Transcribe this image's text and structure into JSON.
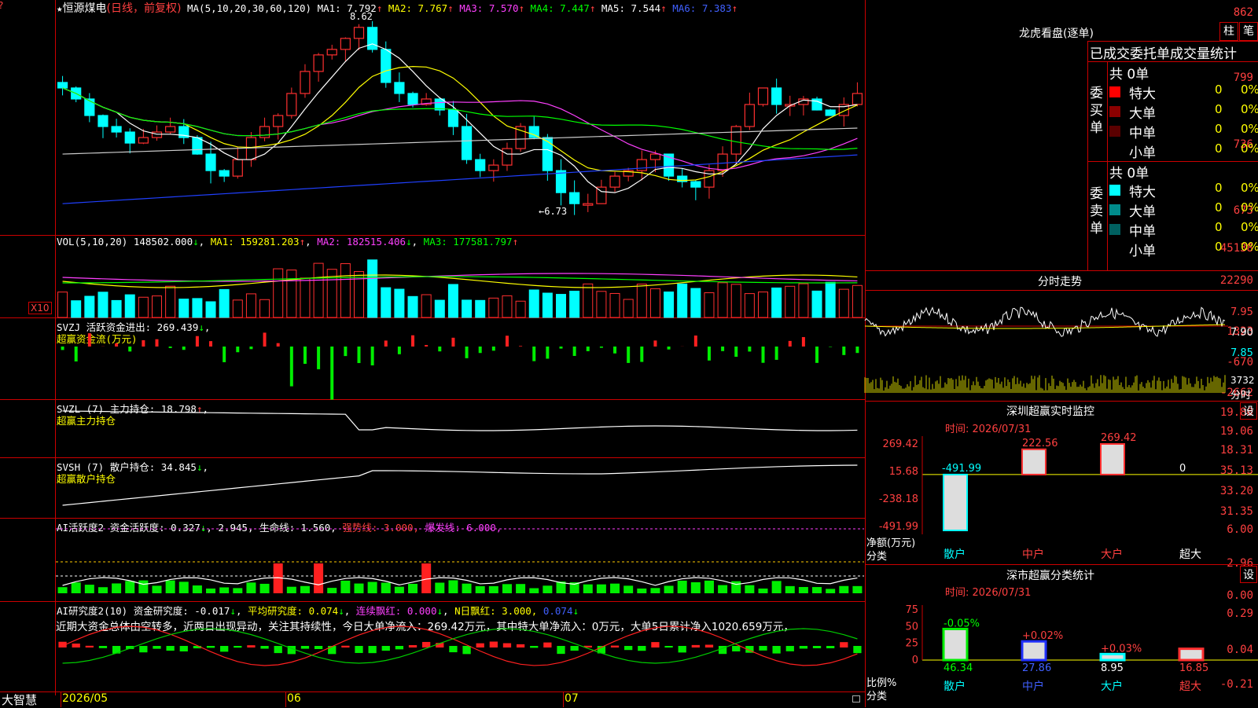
{
  "stock": {
    "star": "★",
    "name": "恒源煤电",
    "mode": "(日线，前复权)",
    "ma_label": "MA(5,10,20,30,60,120)",
    "ma_values": [
      {
        "label": "MA1:",
        "value": "7.792",
        "arrow": "↑",
        "color": "#ffffff"
      },
      {
        "label": "MA2:",
        "value": "7.767",
        "arrow": "↑",
        "color": "#ffff00"
      },
      {
        "label": "MA3:",
        "value": "7.570",
        "arrow": "↑",
        "color": "#ff40ff"
      },
      {
        "label": "MA4:",
        "value": "7.447",
        "arrow": "↑",
        "color": "#00ff00"
      },
      {
        "label": "MA5:",
        "value": "7.544",
        "arrow": "↑",
        "color": "#ffffff"
      },
      {
        "label": "MA6:",
        "value": "7.383",
        "arrow": "↑",
        "color": "#4060ff"
      }
    ],
    "high_mark": "8.62",
    "low_mark": "←6.73"
  },
  "price_axis": [
    "862",
    "799",
    "736",
    "673"
  ],
  "vol": {
    "header": "VOL(5,10,20)",
    "value": "148502.000",
    "arrow": "↓",
    "ma1": "MA1: 159281.203",
    "ma1_arrow": "↑",
    "ma2": "MA2: 182515.406",
    "ma2_arrow": "↓",
    "ma3": "MA3: 177581.797",
    "ma3_arrow": "↑",
    "axis": [
      "45138",
      "22290"
    ],
    "unit": "X10"
  },
  "svzj": {
    "header": "SVZJ  活跃资金进出: 269.439",
    "arrow": "↓",
    "sub": "超赢资金流(万元)",
    "axis": [
      "1323",
      "-670",
      "-2662"
    ]
  },
  "svzl": {
    "header": "SVZL (7) 主力持仓: 18.798",
    "arrow": "↑",
    "sub": "超赢主力持仓",
    "axis": [
      "19.80",
      "19.06",
      "18.31"
    ]
  },
  "svsh": {
    "header": "SVSH (7) 散户持仓: 34.845",
    "arrow": "↓",
    "sub": "超赢散户持仓",
    "axis": [
      "35.13",
      "33.20",
      "31.35"
    ]
  },
  "ai_active": {
    "header": "AI活跃度2 资金活跃度: 0.327",
    "a1": "↓",
    "v2": "2.945",
    "life": "生命线: 1.560,",
    "strong": "强势线: 3.000,",
    "burst": "爆发线: 6.000,",
    "axis": [
      "6.00",
      "2.96",
      "0.00"
    ]
  },
  "ai_research": {
    "h1": "AI研究度2(10) 资金研究度: -0.017",
    "a1": "↓",
    "h2": "平均研究度: 0.074",
    "a2": "↓",
    "h3": "连续飘红: 0.000",
    "a3": "↓",
    "h4": "N日飘红: 3.000,",
    "h5": "0.074",
    "a5": "↓",
    "note": "近期大资金总体由空转多，近两日出现异动，关注其持续性，今日大单净流入：269.42万元，其中特大单净流入：0万元，大单5日累计净入1020.659万元，",
    "axis": [
      "0.29",
      "0.04",
      "-0.21"
    ]
  },
  "bottom": {
    "brand": "大智慧",
    "dates": [
      "2026/05",
      "06",
      "07"
    ]
  },
  "dragon": {
    "title": "龙虎看盘(逐单)",
    "btn1": "柱",
    "btn2": "笔",
    "section": "已成交委托单成交量统计",
    "buy": {
      "label": "委买单",
      "total": "共 0单",
      "rows": [
        {
          "name": "特大",
          "n": "0",
          "p": "0%",
          "color": "#ff0000"
        },
        {
          "name": "大单",
          "n": "0",
          "p": "0%",
          "color": "#8b0000"
        },
        {
          "name": "中单",
          "n": "0",
          "p": "0%",
          "color": "#5a0000"
        },
        {
          "name": "小单",
          "n": "0",
          "p": "0%",
          "color": "#000000"
        }
      ]
    },
    "sell": {
      "label": "委卖单",
      "total": "共 0单",
      "rows": [
        {
          "name": "特大",
          "n": "0",
          "p": "0%",
          "color": "#00ffff"
        },
        {
          "name": "大单",
          "n": "0",
          "p": "0%",
          "color": "#008b8b"
        },
        {
          "name": "中单",
          "n": "0",
          "p": "0%",
          "color": "#006060"
        },
        {
          "name": "小单",
          "n": "0",
          "p": "0%",
          "color": "#000000"
        }
      ]
    }
  },
  "intraday": {
    "title": "分时走势",
    "axis": [
      "7.95",
      "7.90",
      "7.85"
    ],
    "vol_value": "3732",
    "vol_label": "分时"
  },
  "monitor": {
    "title": "深圳超赢实时监控",
    "btn": "设",
    "time": "时间: 2026/07/31",
    "axis": [
      "269.42",
      "15.68",
      "-238.18",
      "-491.99"
    ],
    "ylabel": "净额(万元)",
    "xlabel": "分类",
    "cats": [
      "散户",
      "中户",
      "大户",
      "超大"
    ],
    "values": [
      -491.99,
      222.56,
      269.42,
      0
    ],
    "labels": [
      "-491.99",
      "222.56",
      "269.42",
      "0"
    ]
  },
  "classify": {
    "title": "深市超赢分类统计",
    "btn": "设",
    "time": "时间: 2026/07/31",
    "axis": [
      "75",
      "50",
      "25",
      "0"
    ],
    "ylabel": "比例%",
    "xlabel": "分类",
    "cats": [
      "散户",
      "中户",
      "大户",
      "超大"
    ],
    "values": [
      46.34,
      27.86,
      8.95,
      16.85
    ],
    "labels": [
      "46.34",
      "27.86",
      "8.95",
      "16.85"
    ],
    "changes": [
      "-0.05%",
      "+0.02%",
      "+0.03%",
      ""
    ]
  }
}
